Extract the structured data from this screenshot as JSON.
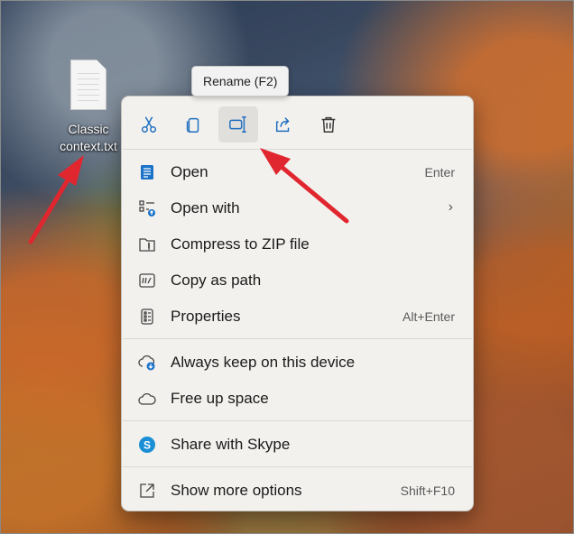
{
  "desktop": {
    "file_label_line1": "Classic",
    "file_label_line2": "context.txt"
  },
  "tooltip": {
    "text": "Rename (F2)"
  },
  "quick_actions": [
    {
      "name": "cut",
      "icon": "scissors-icon"
    },
    {
      "name": "copy",
      "icon": "copy-icon"
    },
    {
      "name": "rename",
      "icon": "rename-icon",
      "active": true
    },
    {
      "name": "share",
      "icon": "share-icon"
    },
    {
      "name": "delete",
      "icon": "trash-icon"
    }
  ],
  "menu": {
    "open": {
      "label": "Open",
      "shortcut": "Enter",
      "icon": "notepad-icon"
    },
    "open_with": {
      "label": "Open with",
      "icon": "open-with-icon",
      "submenu": "›"
    },
    "compress": {
      "label": "Compress to ZIP file",
      "icon": "zip-folder-icon"
    },
    "copy_path": {
      "label": "Copy as path",
      "icon": "path-icon"
    },
    "properties": {
      "label": "Properties",
      "shortcut": "Alt+Enter",
      "icon": "properties-icon"
    },
    "keep_on_device": {
      "label": "Always keep on this device",
      "icon": "cloud-download-icon"
    },
    "free_space": {
      "label": "Free up space",
      "icon": "cloud-icon"
    },
    "skype": {
      "label": "Share with Skype",
      "icon": "skype-icon"
    },
    "more_options": {
      "label": "Show more options",
      "shortcut": "Shift+F10",
      "icon": "more-options-icon"
    }
  },
  "colors": {
    "accent": "#1a73c9",
    "arrow": "#e0262f",
    "menu_bg": "#f3f1ee"
  }
}
